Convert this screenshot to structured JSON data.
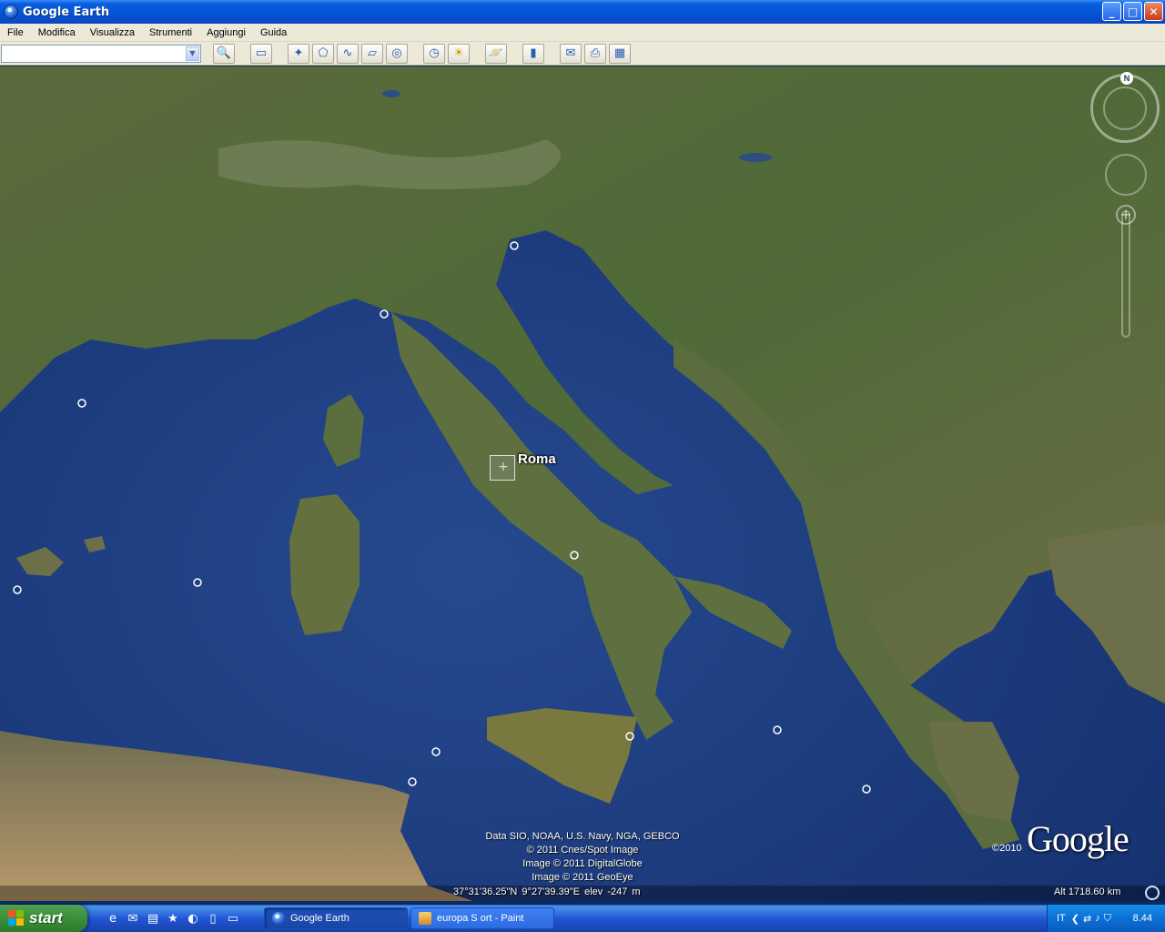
{
  "window": {
    "title": "Google Earth"
  },
  "window_controls": {
    "minimize": "_",
    "maximize": "□",
    "close": "✕"
  },
  "menu": {
    "items": [
      {
        "label": "File"
      },
      {
        "label": "Modifica"
      },
      {
        "label": "Visualizza"
      },
      {
        "label": "Strumenti"
      },
      {
        "label": "Aggiungi"
      },
      {
        "label": "Guida"
      }
    ]
  },
  "toolbar": {
    "search_value": "",
    "buttons": [
      {
        "name": "search-button",
        "icon": "magnifier-icon",
        "glyph": "🔍"
      },
      {
        "name": "sidebar-toggle-button",
        "icon": "sidebar-icon",
        "glyph": "▭"
      },
      {
        "name": "add-placemark-button",
        "icon": "placemark-icon",
        "glyph": "✦"
      },
      {
        "name": "add-polygon-button",
        "icon": "polygon-icon",
        "glyph": "⬠"
      },
      {
        "name": "add-path-button",
        "icon": "path-icon",
        "glyph": "∿"
      },
      {
        "name": "add-image-overlay-button",
        "icon": "overlay-icon",
        "glyph": "▱"
      },
      {
        "name": "record-tour-button",
        "icon": "tour-icon",
        "glyph": "◎"
      },
      {
        "name": "historical-imagery-button",
        "icon": "clock-icon",
        "glyph": "◷"
      },
      {
        "name": "sunlight-button",
        "icon": "sun-icon",
        "glyph": "☀"
      },
      {
        "name": "switch-planet-button",
        "icon": "planet-icon",
        "glyph": "🪐"
      },
      {
        "name": "ruler-button",
        "icon": "ruler-icon",
        "glyph": "▮"
      },
      {
        "name": "email-button",
        "icon": "email-icon",
        "glyph": "✉"
      },
      {
        "name": "print-button",
        "icon": "print-icon",
        "glyph": "⎙"
      },
      {
        "name": "view-in-maps-button",
        "icon": "maps-icon",
        "glyph": "▦"
      }
    ]
  },
  "map": {
    "place_label": "Roma",
    "credits": [
      "Data SIO, NOAA, U.S. Navy, NGA, GEBCO",
      "© 2011 Cnes/Spot Image",
      "Image © 2011 DigitalGlobe",
      "Image © 2011 GeoEye"
    ],
    "coords": {
      "lat": "37°31'36.25\"N",
      "lon": "9°27'39.39\"E",
      "elev": "elev -247 m"
    },
    "altitude": "Alt  1718.60 km",
    "copyright": "©2010",
    "logo": "Google",
    "north": "N"
  },
  "taskbar": {
    "start_label": "start",
    "quick_launch": [
      "e",
      "✉",
      "▤",
      "★",
      "◐",
      "▯",
      "▭"
    ],
    "tasks": [
      {
        "label": "Google Earth",
        "icon": "google-earth-icon"
      },
      {
        "label": "europa S ort - Paint",
        "icon": "paint-icon"
      }
    ],
    "tray": {
      "lang": "IT",
      "icons": [
        "❮",
        "⇄",
        "♪",
        "⛉"
      ],
      "time": "8.44"
    }
  },
  "colors": {
    "titlebar": "#0553d6",
    "taskbar": "#2157d7",
    "start": "#3b8f3b",
    "sea": "#1c3a7a"
  }
}
